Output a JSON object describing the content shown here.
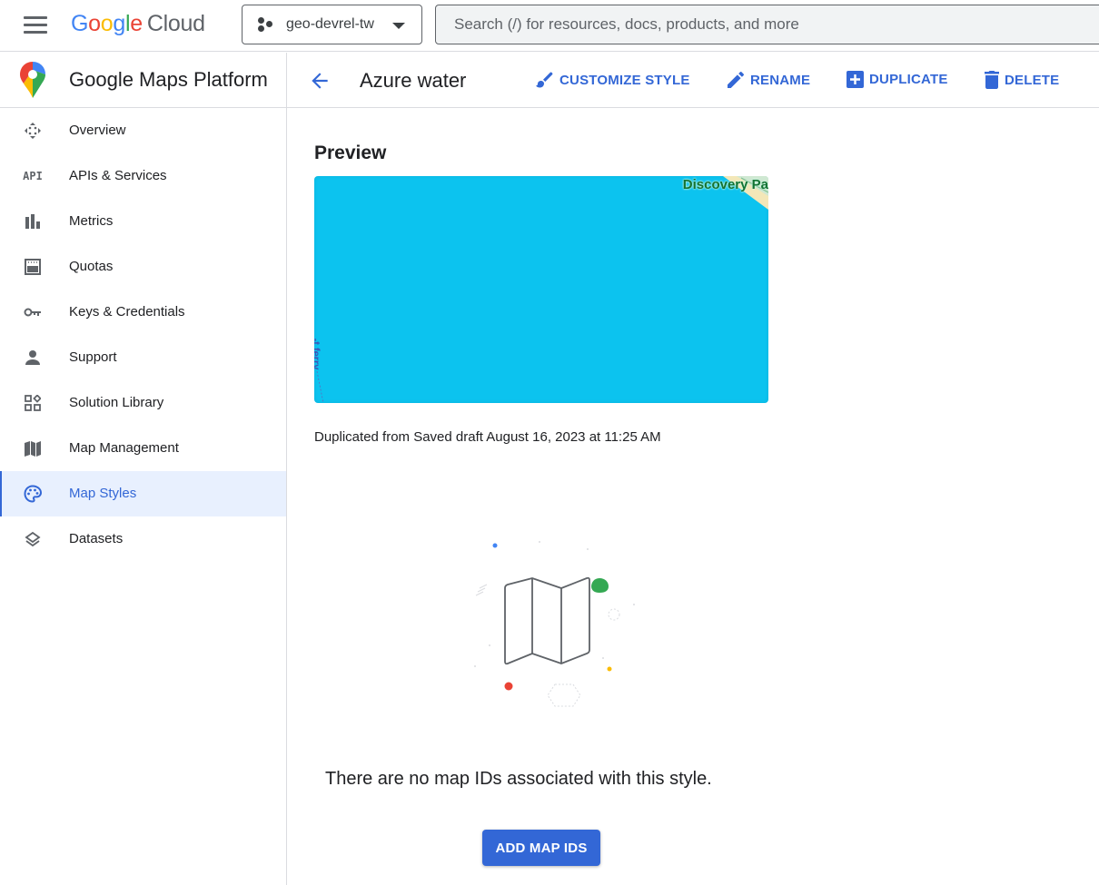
{
  "topbar": {
    "menu_icon": "hamburger-menu-icon",
    "logo": {
      "google_letters": [
        "G",
        "o",
        "o",
        "g",
        "l",
        "e"
      ],
      "suffix": "Cloud"
    },
    "project_picker": {
      "label": "geo-devrel-tw",
      "icon": "project-hierarchy-icon"
    },
    "search": {
      "placeholder": "Search (/) for resources, docs, products, and more",
      "value": ""
    }
  },
  "sidebar": {
    "product_title": "Google Maps Platform",
    "items": [
      {
        "label": "Overview",
        "icon": "overview-icon",
        "active": false
      },
      {
        "label": "APIs & Services",
        "icon": "api-icon",
        "active": false
      },
      {
        "label": "Metrics",
        "icon": "bar-chart-icon",
        "active": false
      },
      {
        "label": "Quotas",
        "icon": "quota-icon",
        "active": false
      },
      {
        "label": "Keys & Credentials",
        "icon": "key-icon",
        "active": false
      },
      {
        "label": "Support",
        "icon": "person-icon",
        "active": false
      },
      {
        "label": "Solution Library",
        "icon": "widgets-icon",
        "active": false
      },
      {
        "label": "Map Management",
        "icon": "map-icon",
        "active": false
      },
      {
        "label": "Map Styles",
        "icon": "palette-icon",
        "active": true
      },
      {
        "label": "Datasets",
        "icon": "layers-icon",
        "active": false
      }
    ]
  },
  "header": {
    "title": "Azure water",
    "actions": [
      {
        "label": "CUSTOMIZE STYLE",
        "icon": "brush-icon"
      },
      {
        "label": "RENAME",
        "icon": "pencil-icon"
      },
      {
        "label": "DUPLICATE",
        "icon": "add-box-icon"
      },
      {
        "label": "DELETE",
        "icon": "trash-icon"
      }
    ]
  },
  "main": {
    "preview_title": "Preview",
    "map_labels": {
      "park": "Discovery Pa",
      "ferry": "-t ferry"
    },
    "duplicated_info": "Duplicated from Saved draft August 16, 2023 at 11:25 AM",
    "empty_message": "There are no map IDs associated with this style.",
    "add_button": "ADD MAP IDS"
  },
  "colors": {
    "accent": "#3367d6",
    "active_bg": "#e8f0fe",
    "water": "#0cc3ef",
    "park_label": "#137333"
  }
}
